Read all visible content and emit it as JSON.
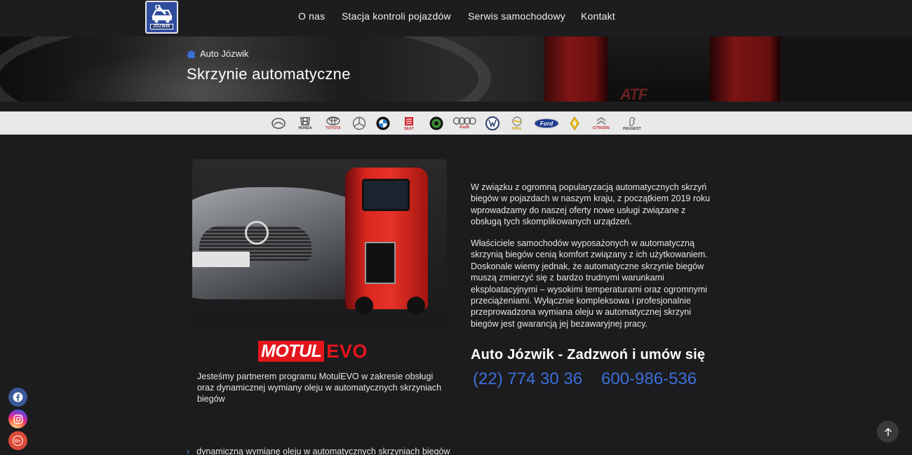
{
  "header": {
    "logo_text": "JÓZWIK",
    "nav": [
      {
        "label": "O nas"
      },
      {
        "label": "Stacja kontroli pojazdów"
      },
      {
        "label": "Serwis samochodowy"
      },
      {
        "label": "Kontakt"
      }
    ]
  },
  "hero": {
    "breadcrumb": "Auto Józwik",
    "title": "Skrzynie automatyczne",
    "overlay_text": "ATF"
  },
  "brands": [
    "HONDA",
    "TOYOTA",
    "SEAT",
    "Audi",
    "OPEL",
    "Ford",
    "CITROËN",
    "PEUGEOT"
  ],
  "content": {
    "motul_brand": "MOTUL",
    "motul_suffix": "EVO",
    "partner_text": "Jesteśmy partnerem programu MotulEVO w zakresie obsługi oraz dynamicznej wymiany oleju w automatycznych skrzyniach biegów",
    "bullet": "dynamiczną wymianę oleju w automatycznych skrzyniach biegów",
    "paragraph1": "W związku z ogromną popularyzacją automatycznych skrzyń biegów w pojazdach w naszym kraju, z początkiem 2019 roku wprowadzamy do naszej oferty nowe usługi związane z obsługą tych skomplikowanych urządzeń.",
    "paragraph2": "Właściciele samochodów wyposażonych w automatyczną skrzynią biegów cenią komfort związany z ich użytkowaniem. Doskonale wiemy jednak, że automatyczne skrzynie biegów muszą zmierzyć się z bardzo trudnymi warunkami eksploatacyjnymi – wysokimi temperaturami oraz ogromnymi przeciążeniami. Wyłącznie kompleksowa i profesjonalnie przeprowadzona wymiana oleju w automatycznej skrzyni biegów jest gwarancją jej bezawaryjnej pracy.",
    "cta": "Auto Józwik - Zadzwoń i umów się",
    "phone1": "(22) 774 30 36",
    "phone2": "600-986-536"
  },
  "colors": {
    "background": "#1c1c1e",
    "phone_blue": "#3c6fd8",
    "motul_red": "#e5151c",
    "brand_strip": "#e9e9e9"
  },
  "icons": [
    "facebook-icon",
    "instagram-icon",
    "google-plus-icon",
    "arrow-up-icon",
    "gear-icon",
    "chevron-right-icon"
  ]
}
